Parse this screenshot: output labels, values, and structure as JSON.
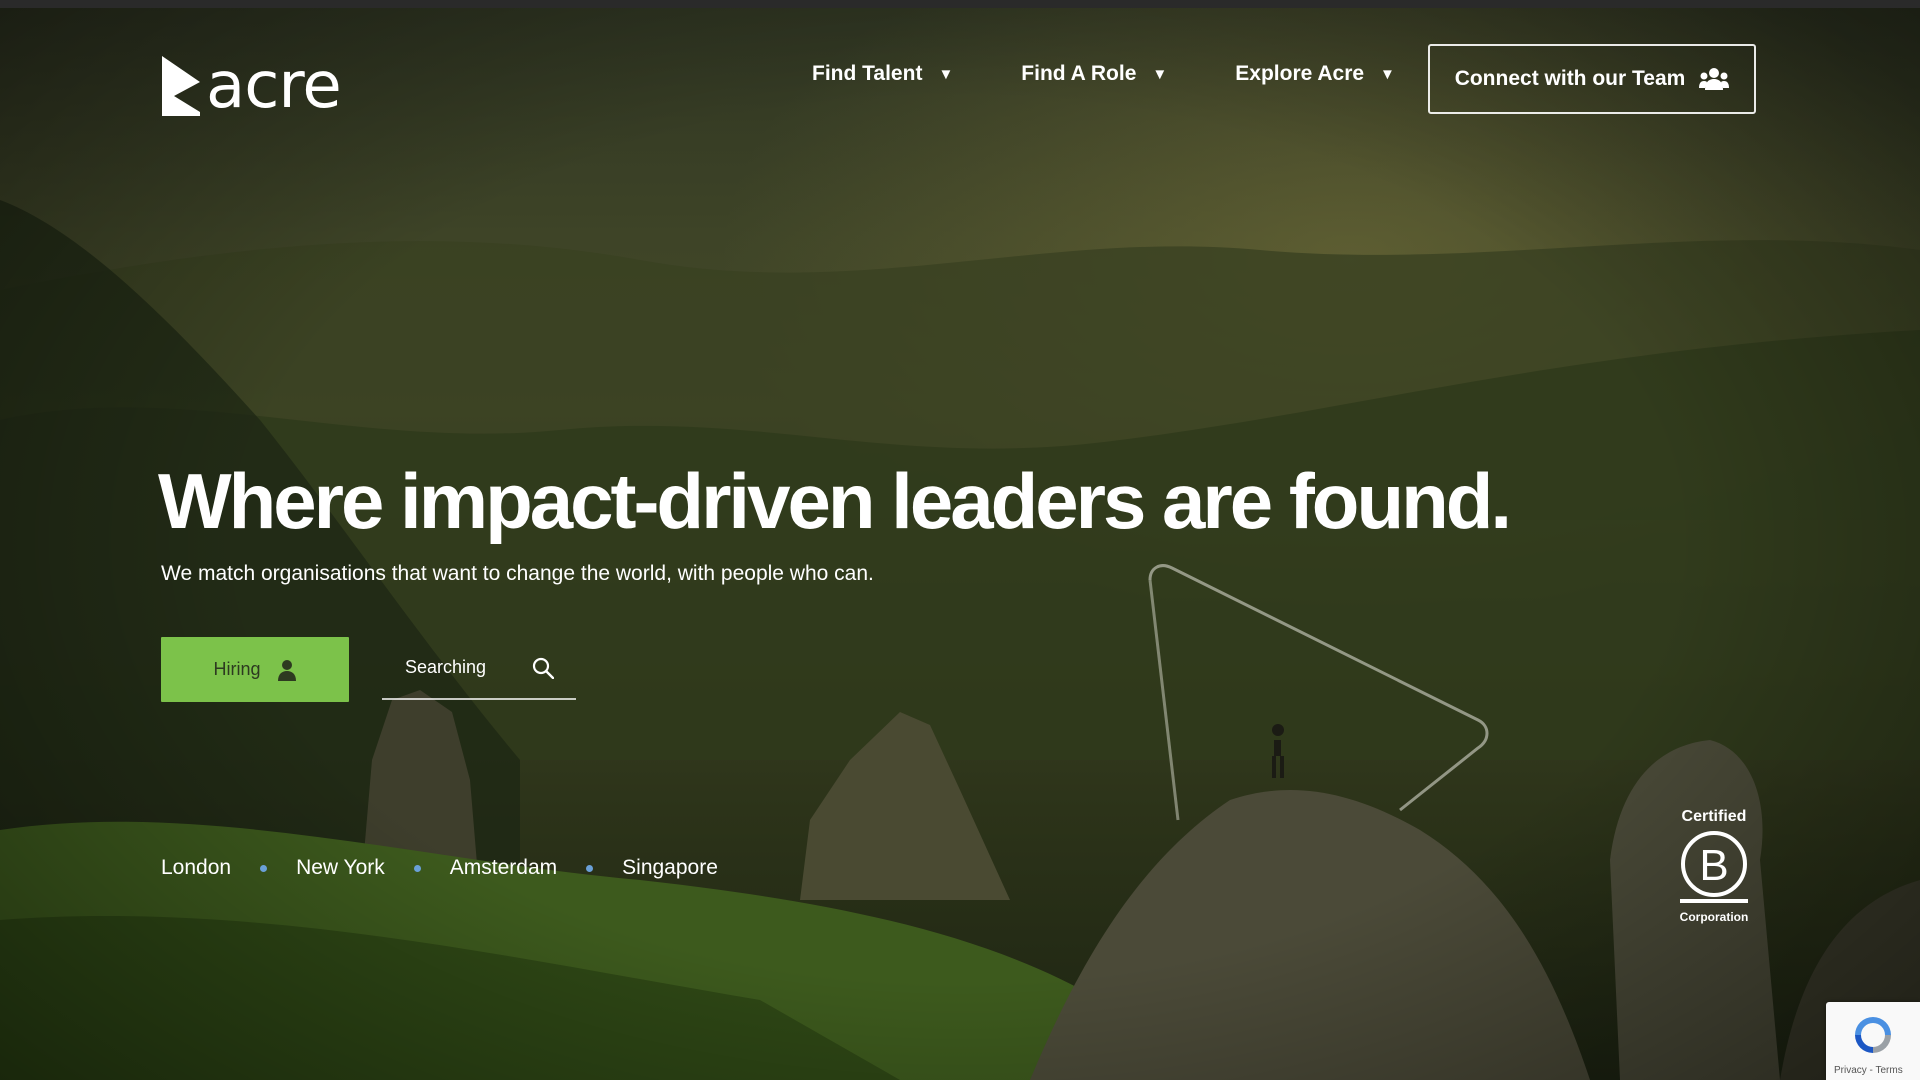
{
  "header": {
    "logo_text": "acre",
    "nav": [
      {
        "label": "Find Talent"
      },
      {
        "label": "Find A Role"
      },
      {
        "label": "Explore Acre"
      }
    ],
    "cta_label": "Connect with our Team"
  },
  "hero": {
    "headline": "Where impact-driven leaders are found.",
    "subheadline": "We match organisations that want to change the world, with people who can.",
    "hiring_label": "Hiring",
    "search_placeholder": "Searching"
  },
  "locations": [
    "London",
    "New York",
    "Amsterdam",
    "Singapore"
  ],
  "badge": {
    "top": "Certified",
    "letter": "B",
    "bottom": "Corporation"
  },
  "recaptcha": {
    "links": "Privacy - Terms"
  },
  "colors": {
    "accent_green": "#7cc24a",
    "location_dot": "#6aa0d8"
  }
}
